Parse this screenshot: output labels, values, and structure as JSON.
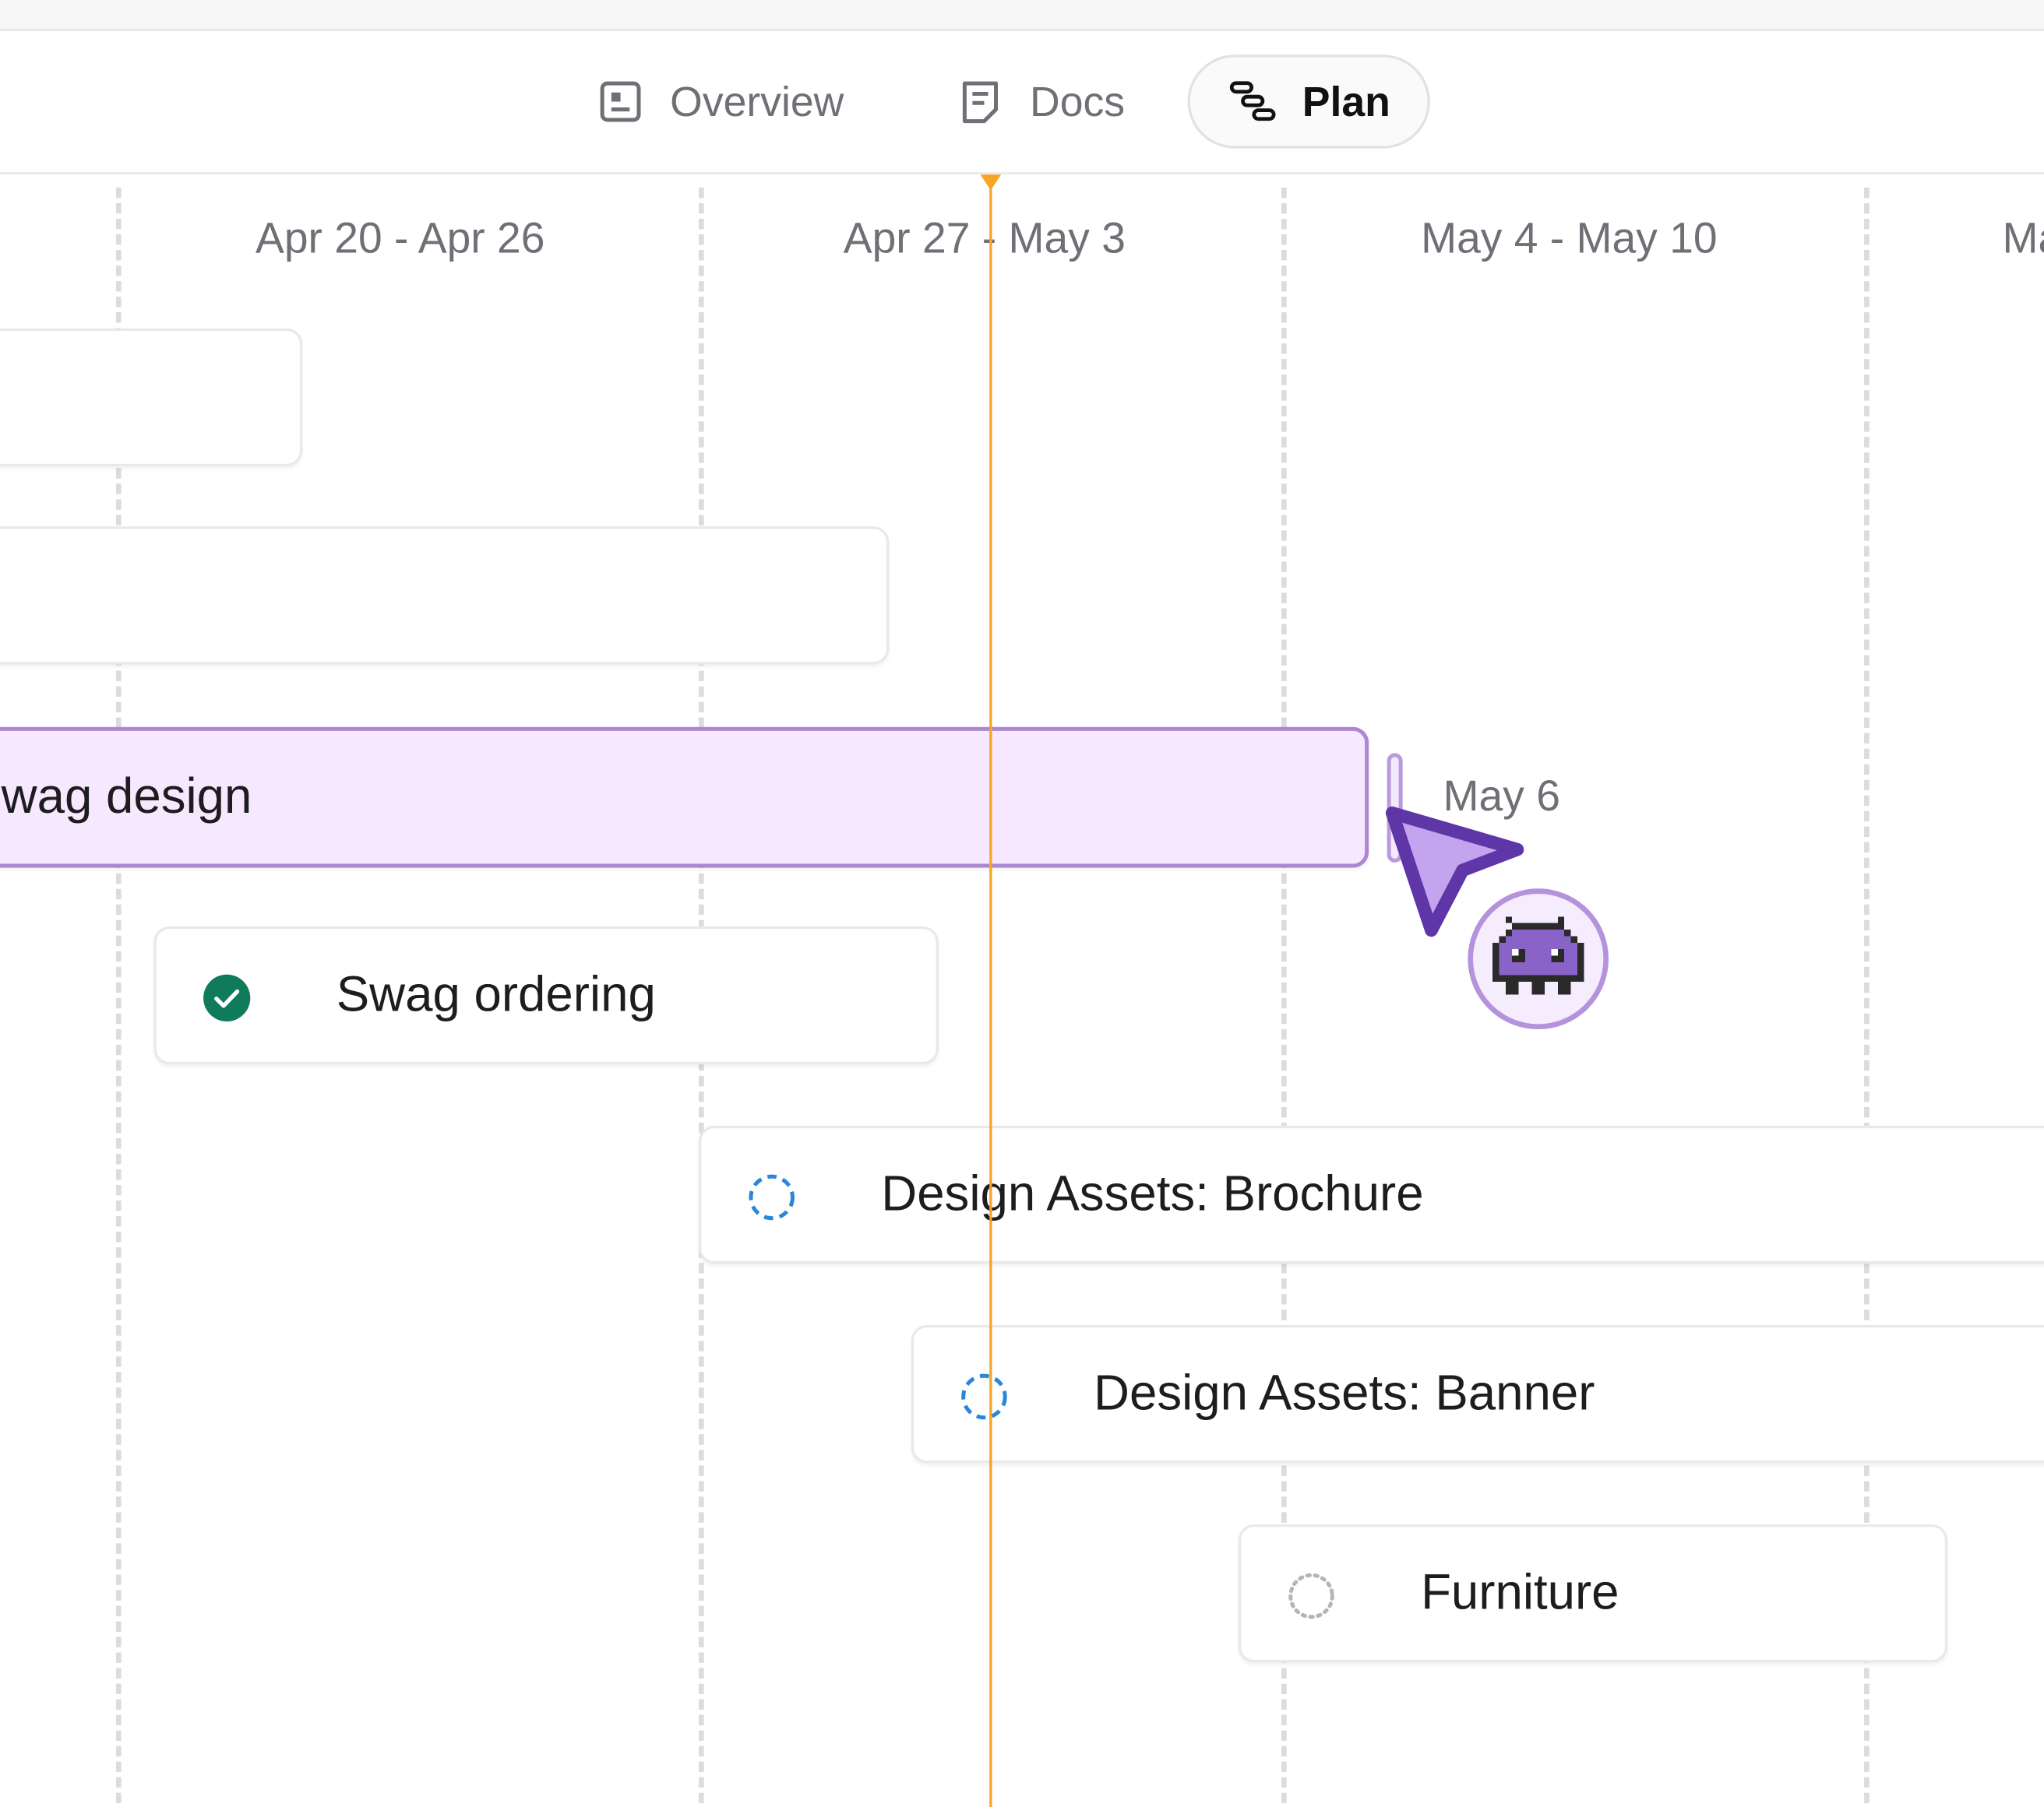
{
  "tabs": [
    {
      "label": "Overview",
      "icon": "overview-icon",
      "active": false
    },
    {
      "label": "Docs",
      "icon": "doc-icon",
      "active": false
    },
    {
      "label": "Plan",
      "icon": "plan-icon",
      "active": true
    }
  ],
  "timeline": {
    "weeks": [
      "Apr 20 - Apr 26",
      "Apr 27 - May 3",
      "May 4 - May 10",
      "Ma"
    ],
    "today_color": "#f5a623",
    "tasks": [
      {
        "label": "",
        "status": "none"
      },
      {
        "label": "",
        "status": "none"
      },
      {
        "label": "wag design",
        "status": "none",
        "selected": true
      },
      {
        "label": "Swag ordering",
        "status": "done"
      },
      {
        "label": "Design Assets: Brochure",
        "status": "in-progress"
      },
      {
        "label": "Design Assets: Banner",
        "status": "in-progress"
      },
      {
        "label": "Furniture",
        "status": "not-started"
      }
    ],
    "drag_tooltip": "May 6"
  },
  "colors": {
    "selected_bg": "#f6e8fe",
    "selected_border": "#ab88cf",
    "done": "#0f7b5b",
    "in_progress": "#2b86d9",
    "cursor": "#5f36a7"
  }
}
